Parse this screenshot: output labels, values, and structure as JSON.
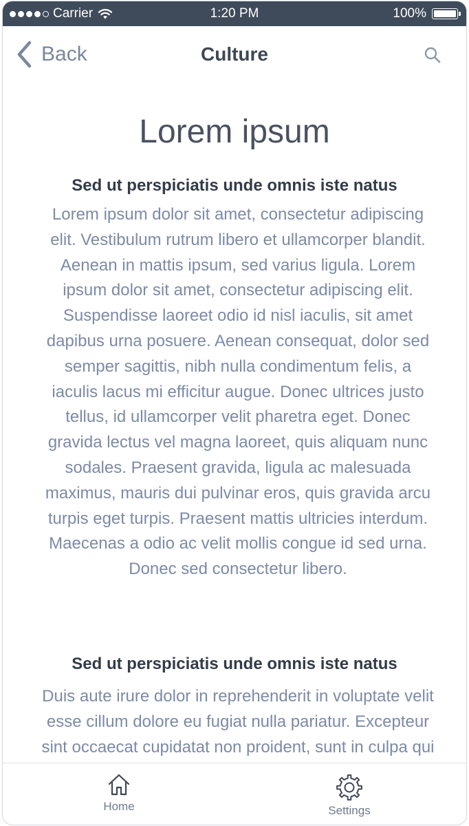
{
  "status_bar": {
    "carrier": "Carrier",
    "time": "1:20 PM",
    "battery": "100%",
    "battery_level": 1.0,
    "signal_bars": 4
  },
  "nav": {
    "back_label": "Back",
    "title": "Culture",
    "back_icon": "chevron-left-icon",
    "search_icon": "search-icon"
  },
  "article": {
    "title": "Lorem ipsum",
    "sections": [
      {
        "heading": "Sed ut perspiciatis unde omnis iste natus",
        "body": "Lorem ipsum dolor sit amet, consectetur adipiscing elit. Vestibulum rutrum libero et ullamcorper blandit. Aenean in mattis ipsum, sed varius ligula. Lorem ipsum dolor sit amet, consectetur adipiscing elit. Suspendisse laoreet odio id nisl iaculis, sit amet dapibus urna posuere. Aenean consequat, dolor sed semper sagittis, nibh nulla condimentum felis, a iaculis lacus mi efficitur augue. Donec ultrices justo tellus, id ullamcorper velit pharetra eget. Donec gravida lectus vel magna laoreet, quis aliquam nunc sodales. Praesent gravida, ligula ac malesuada maximus, mauris dui pulvinar eros, quis gravida arcu turpis eget turpis. Praesent mattis ultricies interdum. Maecenas a odio ac velit mollis congue id sed urna. Donec sed consectetur libero."
      },
      {
        "heading": "Sed ut perspiciatis unde omnis iste natus",
        "body": "Duis aute irure dolor in reprehenderit in voluptate velit esse cillum dolore eu fugiat nulla pariatur. Excepteur sint occaecat cupidatat non proident, sunt in culpa qui officia deserunt mollit anim id est laborum."
      }
    ]
  },
  "tab_bar": {
    "items": [
      {
        "label": "Home",
        "icon": "home-icon"
      },
      {
        "label": "Settings",
        "icon": "gear-icon"
      }
    ]
  },
  "colors": {
    "status_bar_bg": "#3f4a5a",
    "body_text": "#7d8aa6",
    "heading_text": "#4a5160",
    "nav_accent": "#7a879c"
  }
}
